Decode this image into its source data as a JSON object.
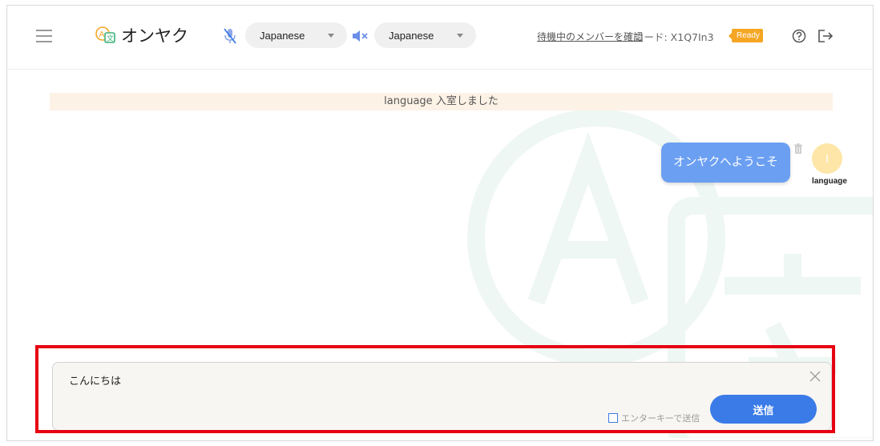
{
  "header": {
    "app_name": "オンヤク",
    "source_language": "Japanese",
    "target_language": "Japanese",
    "waiting_members_link": "待機中のメンバーを確認",
    "room_code": "コード: X1Q7In3",
    "status_badge": "Ready"
  },
  "chat": {
    "system_message": "language 入室しました",
    "messages": [
      {
        "text": "オンヤクへようこそ",
        "sender": "language",
        "avatar_initial": "l"
      }
    ]
  },
  "composer": {
    "input_value": "こんにちは",
    "enter_to_send_label": "エンターキーで送信",
    "send_label": "送信"
  },
  "colors": {
    "accent_blue": "#3a7be8",
    "bubble_blue": "#6b9ff2",
    "ready_orange": "#f5a623",
    "system_bg": "#fdf2e6",
    "avatar_bg": "#fde6a8",
    "highlight_red": "#e60012"
  }
}
